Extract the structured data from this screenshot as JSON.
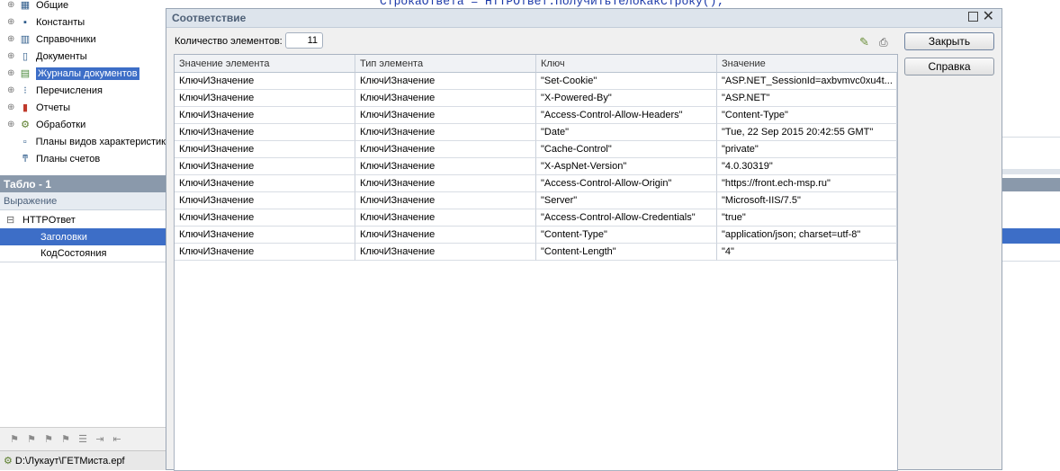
{
  "background_code": "СтрокаОтвета = HTTPОтвет.ПолучитьТелоКакСтроку();",
  "tree": [
    {
      "label": "Общие",
      "icon": "folder-icon",
      "expand": "⊕"
    },
    {
      "label": "Константы",
      "icon": "constants-icon",
      "expand": "⊕"
    },
    {
      "label": "Справочники",
      "icon": "catalogs-icon",
      "expand": "⊕"
    },
    {
      "label": "Документы",
      "icon": "documents-icon",
      "expand": "⊕"
    },
    {
      "label": "Журналы документов",
      "icon": "journals-icon",
      "expand": "⊕"
    },
    {
      "label": "Перечисления",
      "icon": "enums-icon",
      "expand": "⊕"
    },
    {
      "label": "Отчеты",
      "icon": "reports-icon",
      "expand": "⊕"
    },
    {
      "label": "Обработки",
      "icon": "processing-icon",
      "expand": "⊕"
    },
    {
      "label": "Планы видов характеристик",
      "icon": "chart-types-icon",
      "expand": ""
    },
    {
      "label": "Планы счетов",
      "icon": "accounts-icon",
      "expand": ""
    }
  ],
  "tablo": {
    "title": "Табло - 1",
    "column": "Выражение",
    "rows": [
      {
        "label": "HTTPОтвет",
        "expand": "⊟",
        "indent": 0
      },
      {
        "label": "Заголовки",
        "expand": "",
        "indent": 1
      },
      {
        "label": "КодСостояния",
        "expand": "",
        "indent": 1
      }
    ]
  },
  "status_path": "D:\\Лукаут\\ГЕТМиста.epf",
  "dialog": {
    "title": "Соответствие",
    "count_label": "Количество элементов:",
    "count_value": "11",
    "close_button": "Закрыть",
    "help_button": "Справка",
    "columns": [
      "Значение элемента",
      "Тип элемента",
      "Ключ",
      "Значение"
    ],
    "rows": [
      [
        "КлючИЗначение",
        "КлючИЗначение",
        "\"Set-Cookie\"",
        "\"ASP.NET_SessionId=axbvmvc0xu4t..."
      ],
      [
        "КлючИЗначение",
        "КлючИЗначение",
        "\"X-Powered-By\"",
        "\"ASP.NET\""
      ],
      [
        "КлючИЗначение",
        "КлючИЗначение",
        "\"Access-Control-Allow-Headers\"",
        "\"Content-Type\""
      ],
      [
        "КлючИЗначение",
        "КлючИЗначение",
        "\"Date\"",
        "\"Tue, 22 Sep 2015 20:42:55 GMT\""
      ],
      [
        "КлючИЗначение",
        "КлючИЗначение",
        "\"Cache-Control\"",
        "\"private\""
      ],
      [
        "КлючИЗначение",
        "КлючИЗначение",
        "\"X-AspNet-Version\"",
        "\"4.0.30319\""
      ],
      [
        "КлючИЗначение",
        "КлючИЗначение",
        "\"Access-Control-Allow-Origin\"",
        "\"https://front.ech-msp.ru\""
      ],
      [
        "КлючИЗначение",
        "КлючИЗначение",
        "\"Server\"",
        "\"Microsoft-IIS/7.5\""
      ],
      [
        "КлючИЗначение",
        "КлючИЗначение",
        "\"Access-Control-Allow-Credentials\"",
        "\"true\""
      ],
      [
        "КлючИЗначение",
        "КлючИЗначение",
        "\"Content-Type\"",
        "\"application/json; charset=utf-8\""
      ],
      [
        "КлючИЗначение",
        "КлючИЗначение",
        "\"Content-Length\"",
        "\"4\""
      ]
    ]
  }
}
